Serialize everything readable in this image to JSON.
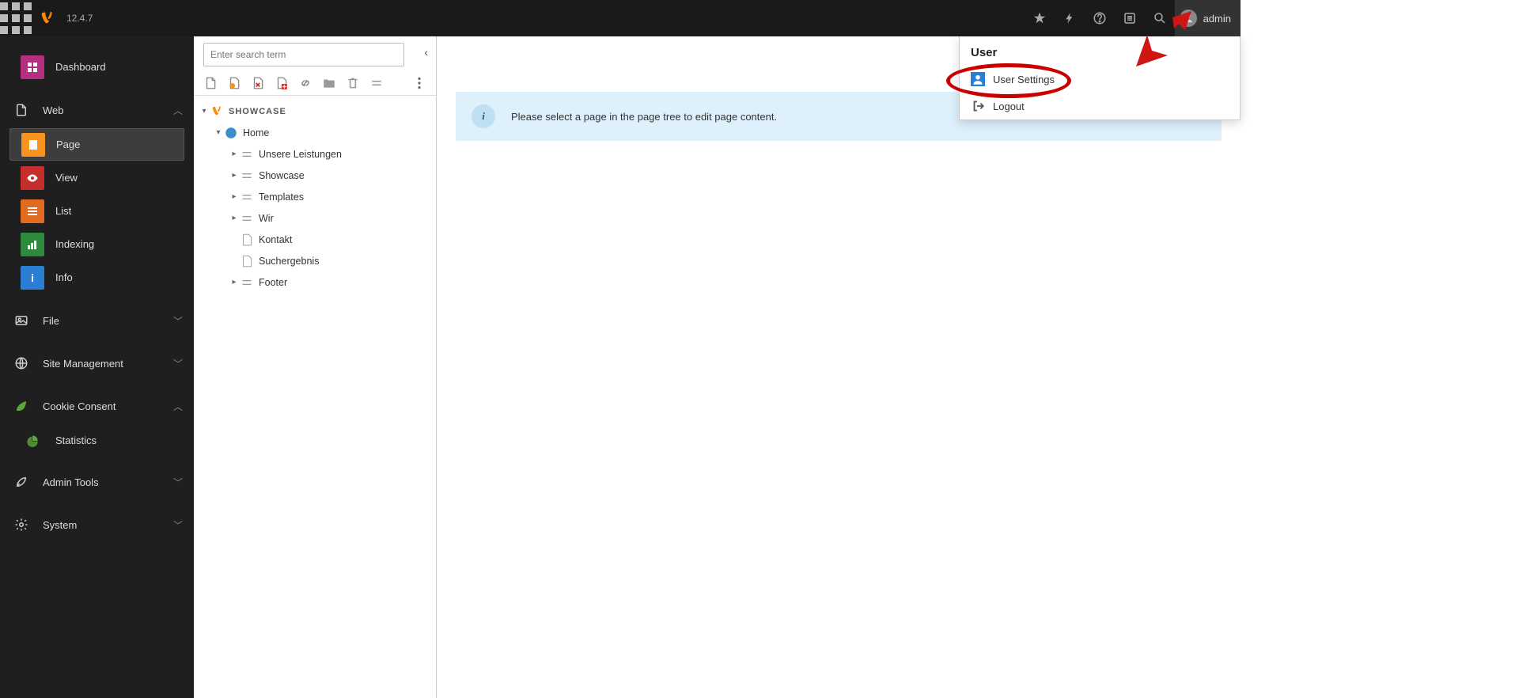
{
  "topbar": {
    "version": "12.4.7",
    "user_label": "admin"
  },
  "sidebar": {
    "dashboard": "Dashboard",
    "groups": [
      {
        "label": "Web",
        "expanded": true,
        "items": [
          "Page",
          "View",
          "List",
          "Indexing",
          "Info"
        ]
      },
      {
        "label": "File",
        "expanded": false
      },
      {
        "label": "Site Management",
        "expanded": false
      },
      {
        "label": "Cookie Consent",
        "expanded": true
      },
      {
        "label": "Statistics"
      },
      {
        "label": "Admin Tools",
        "expanded": false
      },
      {
        "label": "System",
        "expanded": false
      }
    ]
  },
  "tree": {
    "search_placeholder": "Enter search term",
    "root": "SHOWCASE",
    "home": "Home",
    "children": [
      "Unsere Leistungen",
      "Showcase",
      "Templates",
      "Wir",
      "Kontakt",
      "Suchergebnis",
      "Footer"
    ]
  },
  "content": {
    "info_message": "Please select a page in the page tree to edit page content."
  },
  "user_menu": {
    "title": "User",
    "settings": "User Settings",
    "logout": "Logout"
  }
}
